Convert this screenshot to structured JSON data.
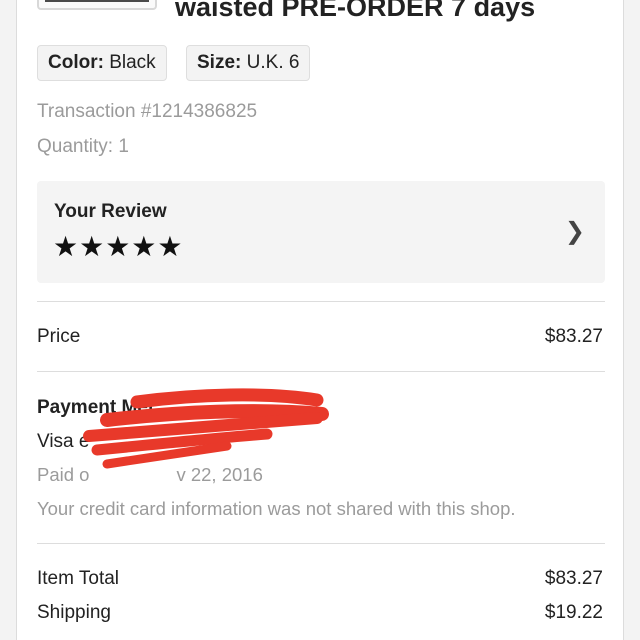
{
  "product": {
    "title_fragment": "waisted PRE-ORDER 7 days"
  },
  "options": [
    {
      "label": "Color:",
      "value": "Black"
    },
    {
      "label": "Size:",
      "value": "U.K. 6"
    }
  ],
  "transaction": "Transaction #1214386825",
  "quantity": "Quantity: 1",
  "review": {
    "title": "Your Review",
    "stars": "★★★★★",
    "rating": 5,
    "chevron_icon": "chevron-right-icon"
  },
  "price": {
    "label": "Price",
    "value": "$83.27"
  },
  "payment": {
    "heading": "Payment Met",
    "method": "Visa e",
    "paid_on": "Paid o",
    "paid_date": "v 22, 2016",
    "note": "Your credit card information was not shared with this shop.",
    "redaction_color": "#e8392a"
  },
  "totals": [
    {
      "label": "Item Total",
      "value": "$83.27"
    },
    {
      "label": "Shipping",
      "value": "$19.22"
    }
  ]
}
